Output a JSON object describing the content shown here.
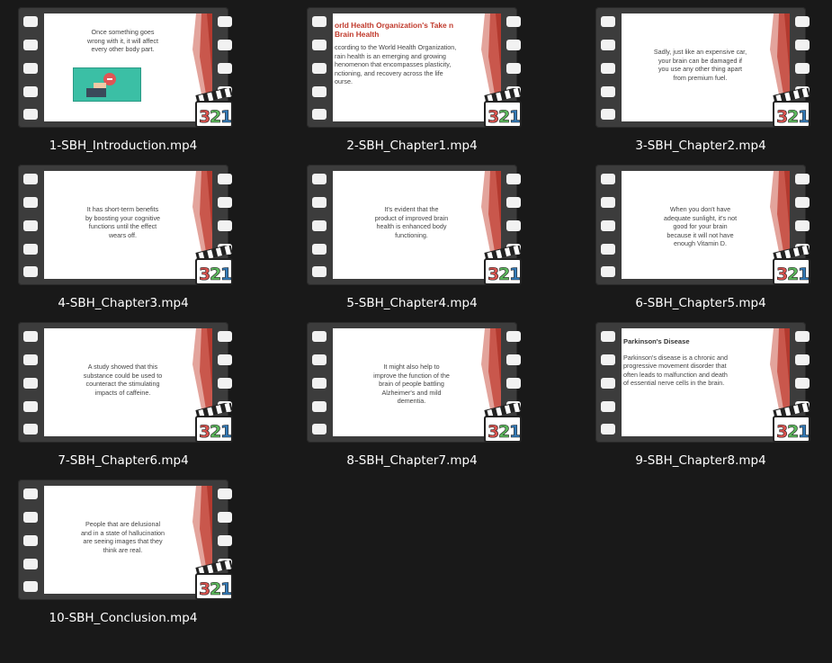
{
  "files": [
    {
      "name": "1-SBH_Introduction.mp4",
      "slide_type": "illustration",
      "slide_lines": [
        "Once something goes",
        "wrong with it, it will affect",
        "every other body part."
      ]
    },
    {
      "name": "2-SBH_Chapter1.mp4",
      "slide_type": "titled-left",
      "slide_title": "orld Health Organization's Take n Brain Health",
      "slide_lines": [
        "ccording to the World Health Organization,",
        "rain health is an emerging and growing",
        "henomenon that encompasses plasticity,",
        "nctioning, and recovery across the life",
        "ourse."
      ]
    },
    {
      "name": "3-SBH_Chapter2.mp4",
      "slide_type": "center",
      "slide_lines": [
        "Sadly, just like an expensive car,",
        "your brain can be damaged if",
        "you use any other thing apart",
        "from premium fuel."
      ]
    },
    {
      "name": "4-SBH_Chapter3.mp4",
      "slide_type": "center",
      "slide_lines": [
        "It has short-term benefits",
        "by boosting your cognitive",
        "functions until the effect",
        "wears off."
      ]
    },
    {
      "name": "5-SBH_Chapter4.mp4",
      "slide_type": "center",
      "slide_lines": [
        "It's evident that the",
        "product of improved brain",
        "health is enhanced body",
        "functioning."
      ]
    },
    {
      "name": "6-SBH_Chapter5.mp4",
      "slide_type": "center",
      "slide_lines": [
        "When you don't have",
        "adequate sunlight, it's not",
        "good for your brain",
        "because it will not have",
        "enough Vitamin D."
      ]
    },
    {
      "name": "7-SBH_Chapter6.mp4",
      "slide_type": "center",
      "slide_lines": [
        "A study showed that this",
        "substance could be used to",
        "counteract the stimulating",
        "impacts of caffeine."
      ]
    },
    {
      "name": "8-SBH_Chapter7.mp4",
      "slide_type": "center",
      "slide_lines": [
        "It might also help to",
        "improve the function of the",
        "brain of people battling",
        "Alzheimer's and mild",
        "dementia."
      ]
    },
    {
      "name": "9-SBH_Chapter8.mp4",
      "slide_type": "titled-left-dark",
      "slide_title": "Parkinson's Disease",
      "slide_lines": [
        "Parkinson's disease is a chronic and",
        "progressive movement disorder that",
        "often leads to malfunction and death",
        "of essential nerve cells in the brain."
      ]
    },
    {
      "name": "10-SBH_Conclusion.mp4",
      "slide_type": "center",
      "slide_lines": [
        "People that are delusional",
        "and in a state of hallucination",
        "are seeing images that they",
        "think are real."
      ]
    }
  ],
  "badge": {
    "icon": "mpc-hc-321-icon",
    "text": "321"
  },
  "colors": {
    "background": "#191919",
    "film": "#3c3c3c",
    "slide_accent": "#c0392b",
    "badge_3": "#d9534f",
    "badge_2": "#5cb85c",
    "badge_1": "#337ab7"
  }
}
